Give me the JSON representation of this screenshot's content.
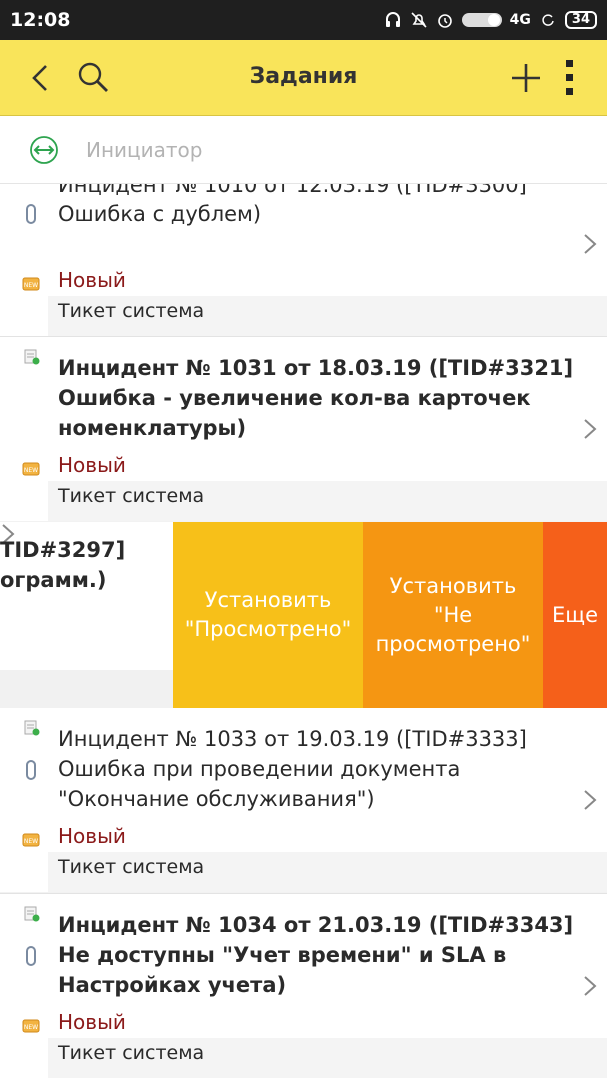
{
  "status_bar": {
    "time": "12:08",
    "network": "4G",
    "battery": "34",
    "icons": [
      "headphones-icon",
      "alarm-off-icon",
      "alarm-icon",
      "toggle-icon",
      "sync-icon"
    ]
  },
  "app_bar": {
    "title": "Задания",
    "icons": [
      "back-icon",
      "search-icon",
      "plus-icon",
      "more-icon"
    ]
  },
  "filter": {
    "placeholder": "Инициатор",
    "icon": "expand-horizontal-icon"
  },
  "items": [
    {
      "title_lines": [
        "Инцидент  № 1010 от 12.03.19 ([TID#3300]",
        "Ошибка с дублем)"
      ],
      "bold": false,
      "status": "Новый",
      "system": "Тикет система"
    },
    {
      "title_lines": [
        "Инцидент  № 1031 от 18.03.19 ([TID#3321]",
        "Ошибка - увеличение кол-ва карточек",
        "номенклатуры)"
      ],
      "bold": true,
      "status": "Новый",
      "system": "Тикет система"
    },
    {
      "title_lines": [
        "Инцидент  № 1033 от 19.03.19 ([TID#3333]",
        "Ошибка при проведении документа",
        "\"Окончание обслуживания\")"
      ],
      "bold": false,
      "status": "Новый",
      "system": "Тикет система"
    },
    {
      "title_lines": [
        "Инцидент  № 1034 от 21.03.19 ([TID#3343]",
        "Не доступны \"Учет времени\" и SLA в",
        "Настройках учета)"
      ],
      "bold": true,
      "status": "Новый",
      "system": "Тикет система"
    }
  ],
  "swiped_item": {
    "fragments": [
      "TID#3297]",
      "ограмм.)"
    ],
    "actions": [
      {
        "label_lines": [
          "Установить",
          "\"Просмотрено\""
        ]
      },
      {
        "label_lines": [
          "Установить",
          "\"Не",
          "просмотрено\""
        ]
      },
      {
        "label_lines": [
          "Еще"
        ]
      }
    ]
  },
  "colors": {
    "app_bar": "#f9e45a",
    "status_new": "#8b1a1a",
    "action_1": "#f7c019",
    "action_2": "#f59612",
    "action_3": "#f5601a",
    "filter_icon": "#2ea44f"
  }
}
